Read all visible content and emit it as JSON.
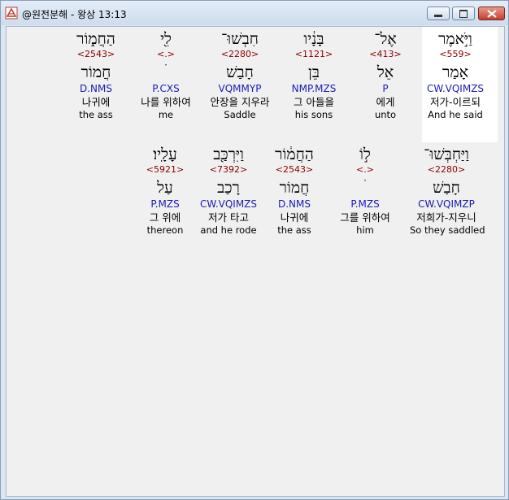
{
  "window": {
    "title": "@원전분해 - 왕상 13:13",
    "icon": "app-icon"
  },
  "colors": {
    "strong": "#8b0000",
    "morph": "#1a1ab8",
    "highlight": "#ffffff"
  },
  "rows": [
    {
      "words": [
        {
          "heb": "וַיֹּ֣אמֶר",
          "strong": "<559>",
          "lemma": "אָמַר",
          "morph": "CW.VQIMZS",
          "kor": "저가-이르되",
          "eng": "And he said"
        },
        {
          "heb": "אֶל־",
          "strong": "<413>",
          "lemma": "אֵל",
          "morph": "P",
          "kor": "에게",
          "eng": "unto"
        },
        {
          "heb": "בָּנָ֔יו",
          "strong": "<1121>",
          "lemma": "בֵּן",
          "morph": "NMP.MZS",
          "kor": "그 아들을",
          "eng": "his sons"
        },
        {
          "heb": "חִבְשׁוּ־",
          "strong": "<2280>",
          "lemma": "חָבַשׁ",
          "morph": "VQMMYP",
          "kor": "안장을 지우라",
          "eng": "Saddle"
        },
        {
          "heb": "לִ֖י",
          "strong": "<.>",
          "lemma": "ׄ",
          "morph": "P.CXS",
          "kor": "나를 위하여",
          "eng": "me"
        },
        {
          "heb": "הַחֲמ֑וֹר",
          "strong": "<2543>",
          "lemma": "חֲמוֹר",
          "morph": "D.NMS",
          "kor": "나귀에",
          "eng": "the ass"
        }
      ]
    },
    {
      "words": [
        {
          "heb": "וַיַּחְבְּשׁוּ־",
          "strong": "<2280>",
          "lemma": "חָבַשׁ",
          "morph": "CW.VQIMZP",
          "kor": "저희가-지우니",
          "eng": "So they saddled"
        },
        {
          "heb": "ל֣וֹ",
          "strong": "<.>",
          "lemma": "ׄ",
          "morph": "P.MZS",
          "kor": "그를 위하여",
          "eng": "him"
        },
        {
          "heb": "הַחֲמ֔וֹר",
          "strong": "<2543>",
          "lemma": "חֲמוֹר",
          "morph": "D.NMS",
          "kor": "나귀에",
          "eng": "the ass"
        },
        {
          "heb": "וַיִּרְכַּ֖ב",
          "strong": "<7392>",
          "lemma": "רָכַב",
          "morph": "CW.VQIMZS",
          "kor": "저가 타고",
          "eng": "and he rode"
        },
        {
          "heb": "עָלָֽיו׃",
          "strong": "<5921>",
          "lemma": "עַל",
          "morph": "P.MZS",
          "kor": "그 위에",
          "eng": "thereon"
        }
      ]
    }
  ]
}
